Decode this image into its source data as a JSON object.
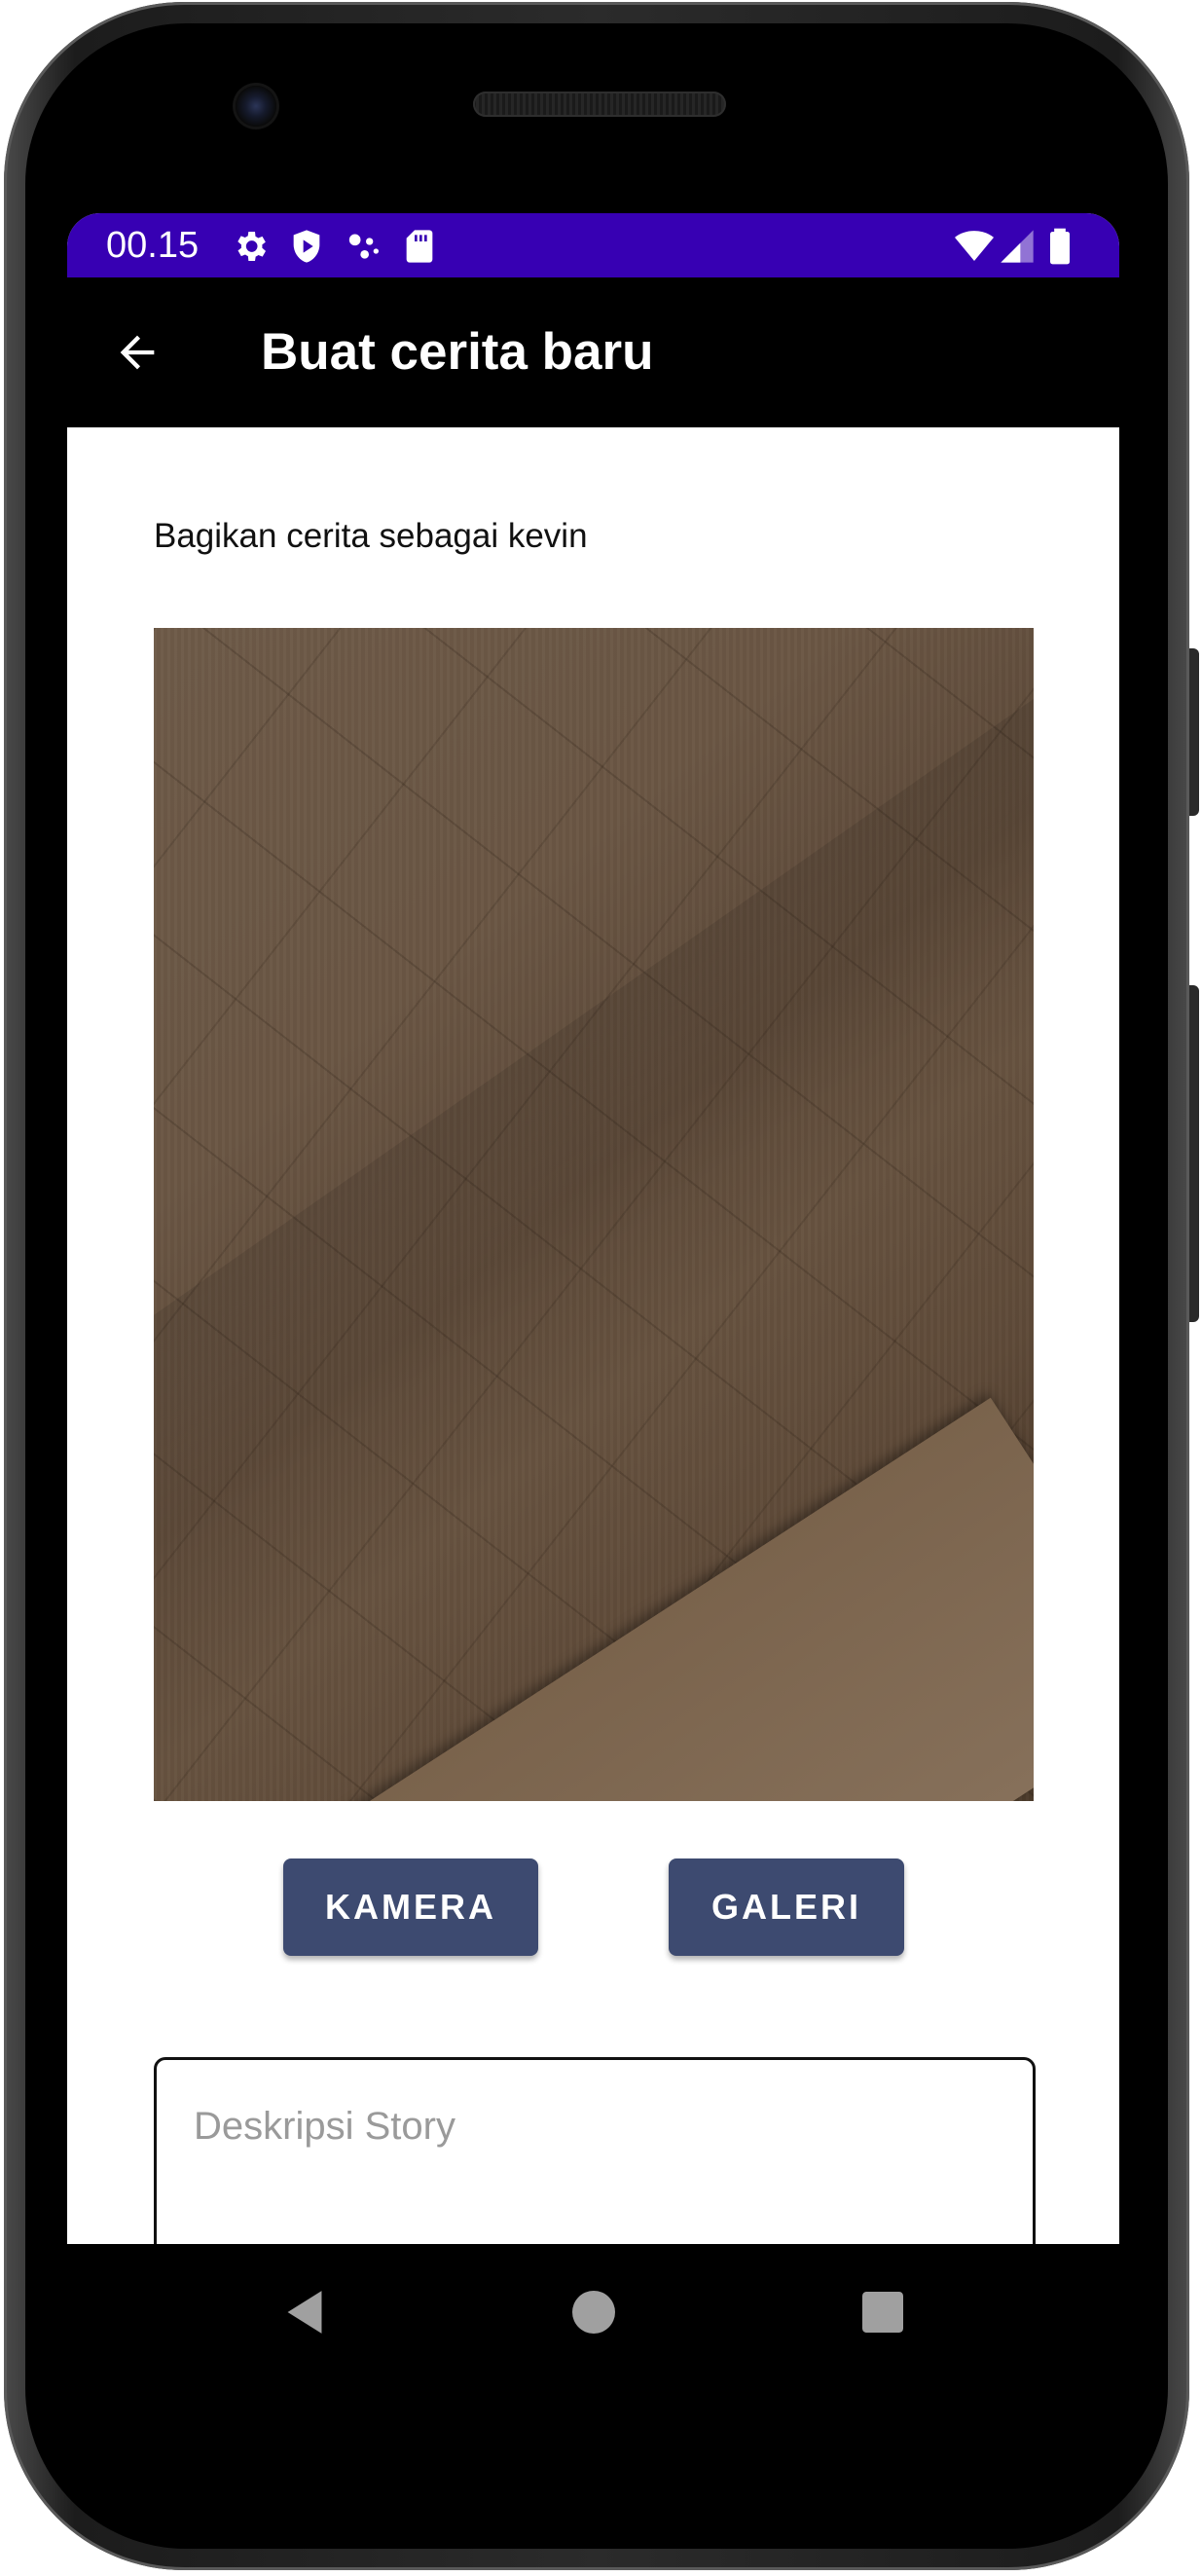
{
  "status_bar": {
    "time": "00.15",
    "color": "#3700b3",
    "icons": [
      "settings-icon",
      "shield-play-icon",
      "assistant-dots-icon",
      "sd-card-icon",
      "wifi-icon",
      "signal-icon",
      "battery-icon"
    ]
  },
  "app_bar": {
    "title": "Buat cerita baru",
    "back_icon": "arrow-left-icon"
  },
  "content": {
    "share_label": "Bagikan cerita sebagai kevin",
    "camera_button": "KAMERA",
    "gallery_button": "GALERI",
    "button_color": "#3d4a70",
    "description": {
      "value": "",
      "placeholder": "Deskripsi Story"
    }
  },
  "nav_bar": {
    "icons": [
      "back-triangle-icon",
      "home-circle-icon",
      "recents-square-icon"
    ]
  }
}
